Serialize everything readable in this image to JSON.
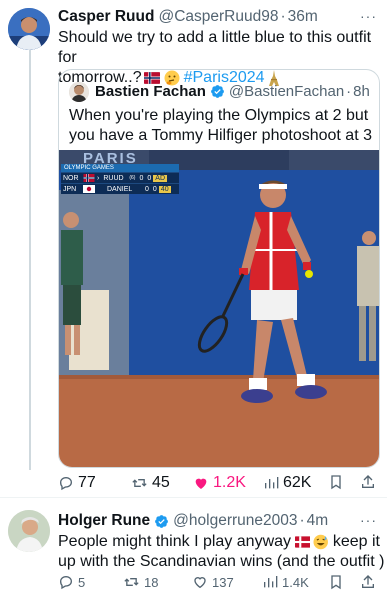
{
  "tweet1": {
    "name": "Casper Ruud",
    "handle": "@CasperRuud98",
    "time": "36m",
    "text_line1": "Should we try to add a little blue to this outfit for",
    "text_line2_prefix": "tomorrow..?",
    "hashtag": "#Paris2024",
    "more": "···"
  },
  "quote": {
    "name": "Bastien Fachan",
    "handle": "@BastienFachan",
    "time": "8h",
    "text_line1": "When you're playing the Olympics at 2 but",
    "text_line2": "you have a Tommy Hilfiger photoshoot at 3",
    "scoreboard": {
      "title": "OLYMPIC GAMES",
      "row1": {
        "country": "NOR",
        "player": "RUUD",
        "seed": "(6)",
        "s1": "0",
        "s2": "0",
        "pts": "AD"
      },
      "row2": {
        "country": "JPN",
        "player": "DANIEL",
        "s1": "0",
        "s2": "0",
        "pts": "40"
      }
    },
    "banner_text": "PARIS"
  },
  "tweet1_actions": {
    "replies": "77",
    "retweets": "45",
    "likes": "1.2K",
    "views": "62K"
  },
  "tweet2": {
    "name": "Holger Rune",
    "handle": "@holgerrune2003",
    "time": "4m",
    "text_line1_prefix": "People might think I play anyway",
    "text_line1_suffix": "keep it",
    "text_line2": "up with the Scandinavian wins  (and the outfit )",
    "more": "···"
  },
  "tweet2_actions": {
    "replies": "5",
    "retweets": "18",
    "likes": "137",
    "views": "1.4K"
  },
  "colors": {
    "accent": "#1d9bf0",
    "like": "#f91880",
    "secondary_text": "#536471",
    "court": "#b86a45",
    "wall": "#1f4fa0"
  }
}
